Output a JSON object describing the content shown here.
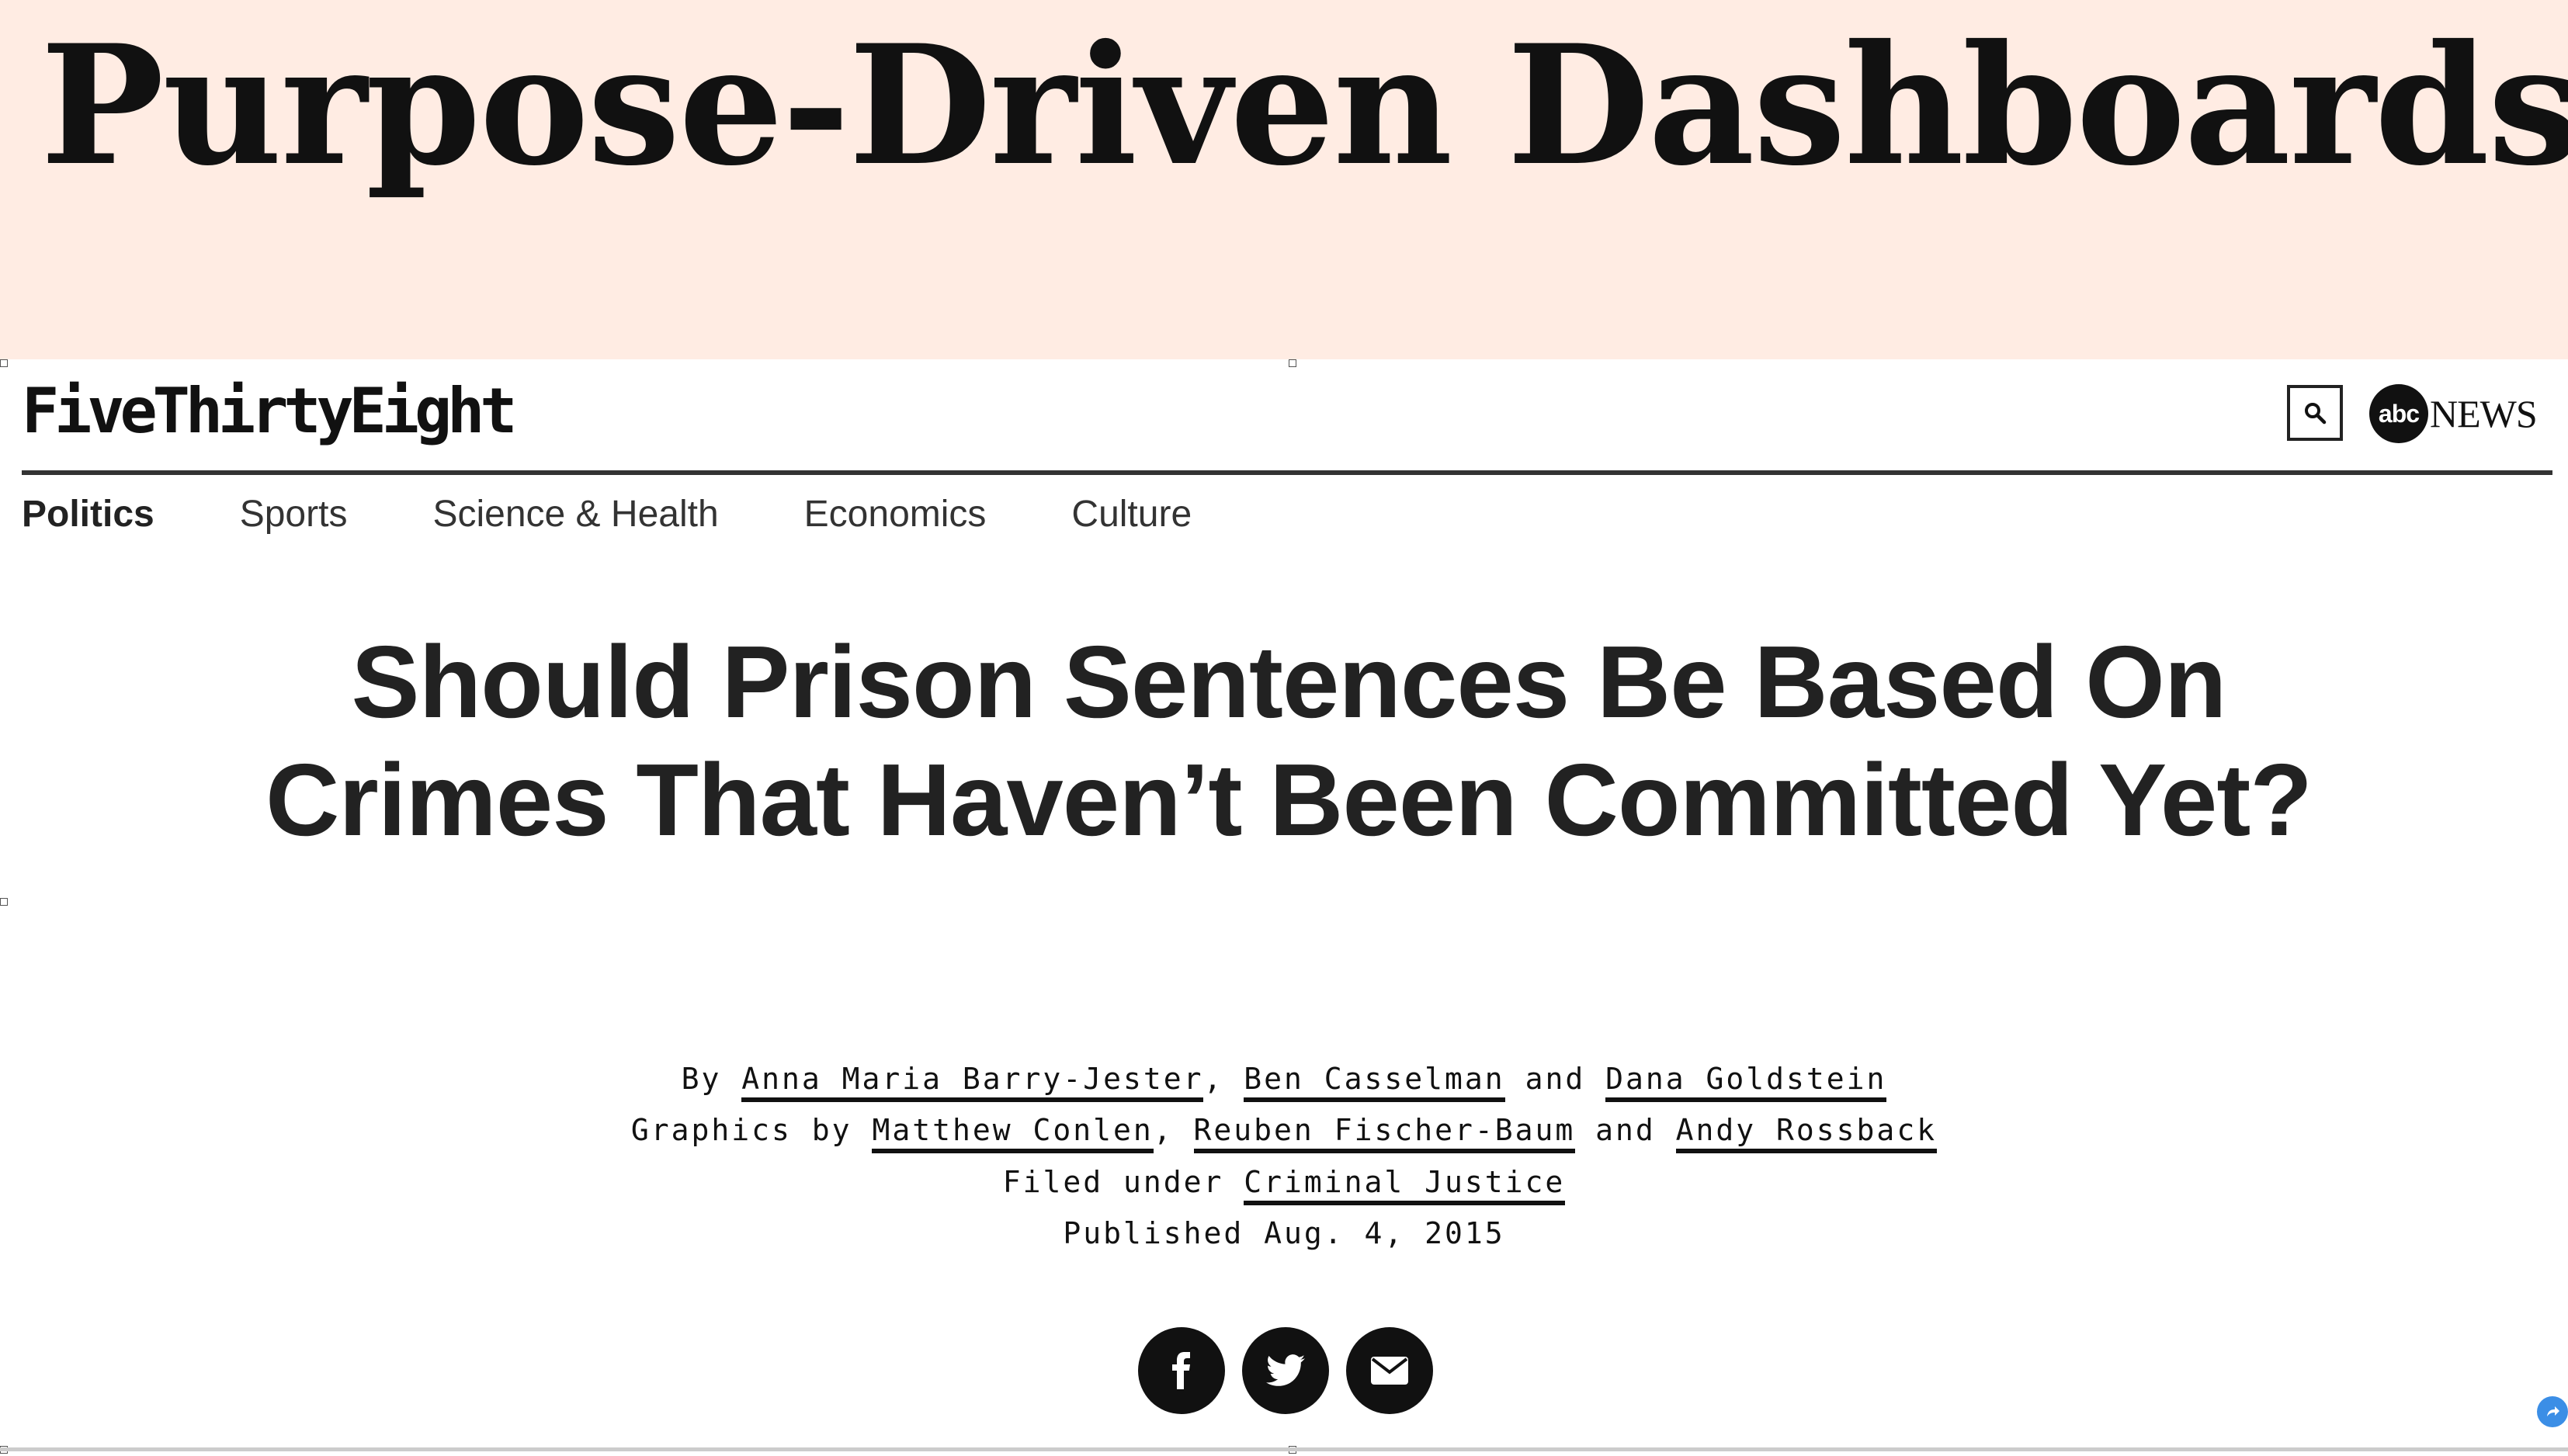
{
  "slide": {
    "title": "Purpose-Driven Dashboards"
  },
  "site": {
    "logo": "FiveThirtyEight",
    "partner_logo_abc": "abc",
    "partner_logo_news": "NEWS"
  },
  "nav": {
    "items": [
      {
        "label": "Politics",
        "active": true
      },
      {
        "label": "Sports"
      },
      {
        "label": "Science & Health"
      },
      {
        "label": "Economics"
      },
      {
        "label": "Culture"
      }
    ]
  },
  "article": {
    "headline": "Should Prison Sentences Be Based On Crimes That Haven’t Been Committed Yet?",
    "byline": {
      "prefix": "By",
      "authors": [
        "Anna Maria Barry-Jester",
        "Ben Casselman",
        "Dana Goldstein"
      ],
      "sep": ",",
      "and": "and"
    },
    "graphics": {
      "prefix": "Graphics by",
      "authors": [
        "Matthew Conlen",
        "Reuben Fischer-Baum",
        "Andy Rossback"
      ]
    },
    "filed": {
      "prefix": "Filed under",
      "topic": "Criminal Justice"
    },
    "published": "Published Aug. 4, 2015"
  },
  "share": {
    "icons": [
      "facebook-icon",
      "twitter-icon",
      "email-icon"
    ]
  },
  "colors": {
    "banner_bg": "#ffece3",
    "text": "#222222",
    "share_bg": "#111111"
  }
}
